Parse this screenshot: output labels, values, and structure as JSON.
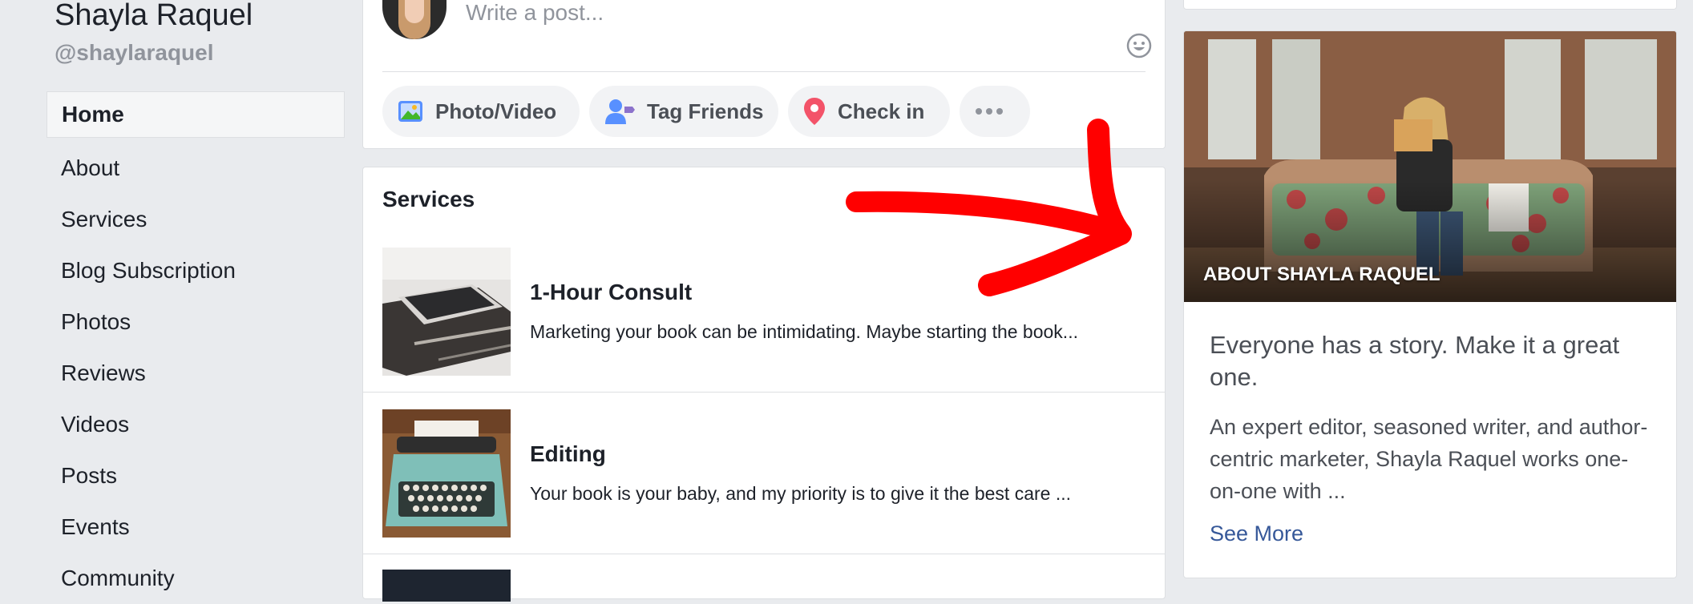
{
  "sidebar": {
    "page_name": "Shayla Raquel",
    "handle": "@shaylaraquel",
    "nav": [
      "Home",
      "About",
      "Services",
      "Blog Subscription",
      "Photos",
      "Reviews",
      "Videos",
      "Posts",
      "Events",
      "Community"
    ],
    "active_index": 0
  },
  "composer": {
    "placeholder": "Write a post...",
    "actions": [
      "Photo/Video",
      "Tag Friends",
      "Check in",
      "more"
    ]
  },
  "services": {
    "heading": "Services",
    "items": [
      {
        "title": "1-Hour Consult",
        "description": "Marketing your book can be intimidating. Maybe starting the book..."
      },
      {
        "title": "Editing",
        "description": "Your book is your baby, and my priority is to give it the best care ..."
      }
    ]
  },
  "about": {
    "photo_label": "ABOUT SHAYLA RAQUEL",
    "tagline": "Everyone has a story. Make it a great one.",
    "bio": "An expert editor, seasoned writer, and author-centric marketer, Shayla Raquel works one-on-one with ...",
    "see_more": "See More"
  },
  "colors": {
    "background": "#e9ebee",
    "link": "#365899",
    "annotation_arrow": "#ff0000",
    "pill_background": "#f2f3f5"
  },
  "icons": {
    "photo_video": "photo-video-icon",
    "tag_friends": "tag-friends-icon",
    "check_in": "location-pin-icon",
    "more": "more-dots-icon",
    "emoji": "smiley-icon"
  }
}
